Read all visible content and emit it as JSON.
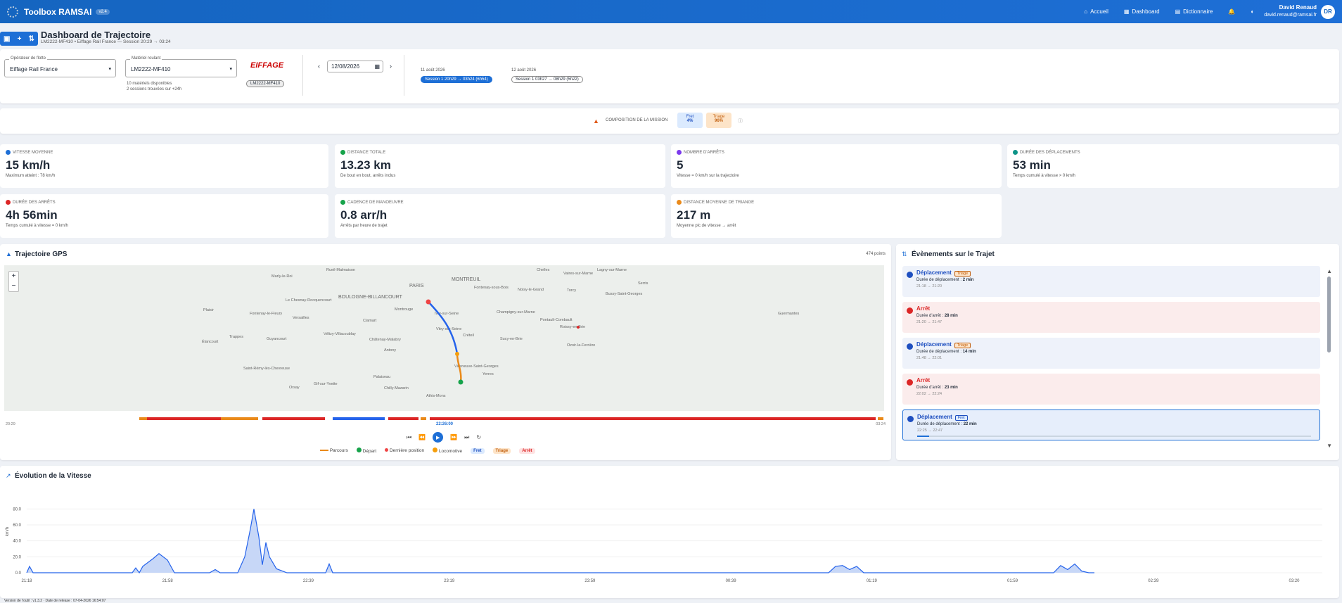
{
  "app": {
    "title": "Toolbox RAMSAI",
    "version": "v2.4"
  },
  "nav": {
    "home": "Accueil",
    "dashboard": "Dashboard",
    "dictionary": "Dictionnaire"
  },
  "user": {
    "name": "David Renaud",
    "email": "david.renaud@ramsai.fr",
    "initials": "DR"
  },
  "page": {
    "title": "Dashboard de Trajectoire",
    "subtitle": "LM2222-MF410 • Eiffage Rail France — Session 20:29 → 03:24"
  },
  "filters": {
    "operator": {
      "label": "Opérateur de flotte",
      "value": "Eiffage Rail France"
    },
    "material": {
      "label": "Matériel roulant",
      "value": "LM2222-MF410",
      "info1": "10 matériels disponibles",
      "info2": "2 sessions trouvées sur +24h"
    },
    "brand": "EIFFAGE",
    "vehicle_chip": "LM2222-MF410",
    "date": "12/08/2026",
    "day1": "11 août 2026",
    "day2": "12 août 2026",
    "session1": "Session 1 20h29 → 03h24 (6h54)",
    "session2": "Session 1 03h27 → 08h29 (5h22)"
  },
  "composition": {
    "label": "COMPOSITION DE LA MISSION",
    "fret_label": "Fret",
    "fret_pct": "4%",
    "triage_label": "Triage",
    "triage_pct": "96%"
  },
  "kpis": [
    {
      "label": "VITESSE MOYENNE",
      "value": "15 km/h",
      "sub": "Maximum atteint : 78 km/h"
    },
    {
      "label": "DISTANCE TOTALE",
      "value": "13.23 km",
      "sub": "De bout en bout, arrêts inclus"
    },
    {
      "label": "NOMBRE D'ARRÊTS",
      "value": "5",
      "sub": "Vitesse = 0 km/h sur la trajectoire"
    },
    {
      "label": "DURÉE DES DÉPLACEMENTS",
      "value": "53 min",
      "sub": "Temps cumulé à vitesse > 0 km/h"
    },
    {
      "label": "DURÉE DES ARRÊTS",
      "value": "4h 56min",
      "sub": "Temps cumulé à vitesse = 0 km/h"
    },
    {
      "label": "CADENCE DE MANOEUVRE",
      "value": "0.8 arr/h",
      "sub": "Arrêts par heure de trajet"
    },
    {
      "label": "DISTANCE MOYENNE DE TRIANGE",
      "value": "217 m",
      "sub": "Moyenne pic de vitesse → arrêt"
    }
  ],
  "map": {
    "title": "Trajectoire GPS",
    "points": "474 points",
    "zoom_in": "+",
    "zoom_out": "−",
    "places": [
      "Marly-le-Roi",
      "Rueil-Malmaison",
      "PARIS",
      "MONTREUIL",
      "Chelles",
      "Vaires-sur-Marne",
      "Lagny-sur-Marne",
      "Serris",
      "Le Chesnay-Rocquencourt",
      "BOULOGNE-BILLANCOURT",
      "Fontenay-sous-Bois",
      "Noisy-le-Grand",
      "Torcy",
      "Bussy-Saint-Georges",
      "Plaisir",
      "Fontenay-le-Fleury",
      "Versailles",
      "Clamart",
      "Montrouge",
      "Ivry-sur-Seine",
      "Champigny-sur-Marne",
      "Pontault-Combault",
      "Trappes",
      "Guyancourt",
      "Vélizy-Villacoublay",
      "Châtenay-Malabry",
      "Vitry-sur-Seine",
      "Créteil",
      "Sucy-en-Brie",
      "Roissy-en-Brie",
      "Élancourt",
      "Antony",
      "Ozoir-la-Ferrière",
      "Guermantes",
      "Palaiseau",
      "Villeneuve-Saint-Georges",
      "Saint-Rémy-lès-Chevreuse",
      "Gif-sur-Yvette",
      "Chilly-Mazarin",
      "Athis-Mons",
      "Yerres",
      "Orsay"
    ],
    "time_start": "20:29",
    "time_end": "03:24",
    "cursor_time": "22:26:00"
  },
  "legend": {
    "path": "Parcours",
    "start": "Départ",
    "last": "Dernière position",
    "loco": "Locomotive",
    "fret": "Fret",
    "triage": "Triage",
    "stop": "Arrêt"
  },
  "events": {
    "title": "Évènements sur le Trajet",
    "items": [
      {
        "type": "Déplacement",
        "tag": "Triage",
        "detail_label": "Durée de déplacement :",
        "detail": "2 min",
        "hours": "21:18 → 21:20",
        "kind": "move"
      },
      {
        "type": "Arrêt",
        "tag": "",
        "detail_label": "Durée d'arrêt :",
        "detail": "28 min",
        "hours": "21:20 → 21:47",
        "kind": "stop"
      },
      {
        "type": "Déplacement",
        "tag": "Triage",
        "detail_label": "Durée de déplacement :",
        "detail": "14 min",
        "hours": "21:48 → 22:01",
        "kind": "move"
      },
      {
        "type": "Arrêt",
        "tag": "",
        "detail_label": "Durée d'arrêt :",
        "detail": "23 min",
        "hours": "22:02 → 22:24",
        "kind": "stop"
      },
      {
        "type": "Déplacement",
        "tag": "Fret",
        "detail_label": "Durée de déplacement :",
        "detail": "22 min",
        "hours": "22:25 → 22:47",
        "kind": "active"
      }
    ]
  },
  "speed": {
    "title": "Évolution de la Vitesse",
    "ylabel": "km/h",
    "yticks": [
      "80.0",
      "60.0",
      "40.0",
      "20.0",
      "0.0"
    ],
    "xticks": [
      "21:18",
      "21:58",
      "22:39",
      "23:19",
      "23:59",
      "00:39",
      "01:19",
      "01:59",
      "02:39",
      "03:20"
    ]
  },
  "chart_data": {
    "type": "area",
    "title": "Évolution de la Vitesse",
    "ylabel": "km/h",
    "ylim": [
      0,
      90
    ],
    "x": [
      "21:18",
      "21:58",
      "22:39",
      "23:19",
      "23:59",
      "00:39",
      "01:19",
      "01:59",
      "02:39",
      "03:20"
    ],
    "series": [
      {
        "values": [
          0,
          24,
          80,
          6,
          0,
          0,
          0,
          9,
          0,
          11
        ]
      }
    ]
  },
  "footer": "Version de l'outil : v1.3.2 · Date de release : 07-04-2026 16:54:07",
  "colors": {
    "primary": "#1e6fd6",
    "fret": "#2563eb",
    "triage": "#ea8a1a",
    "stop": "#dc2626"
  }
}
